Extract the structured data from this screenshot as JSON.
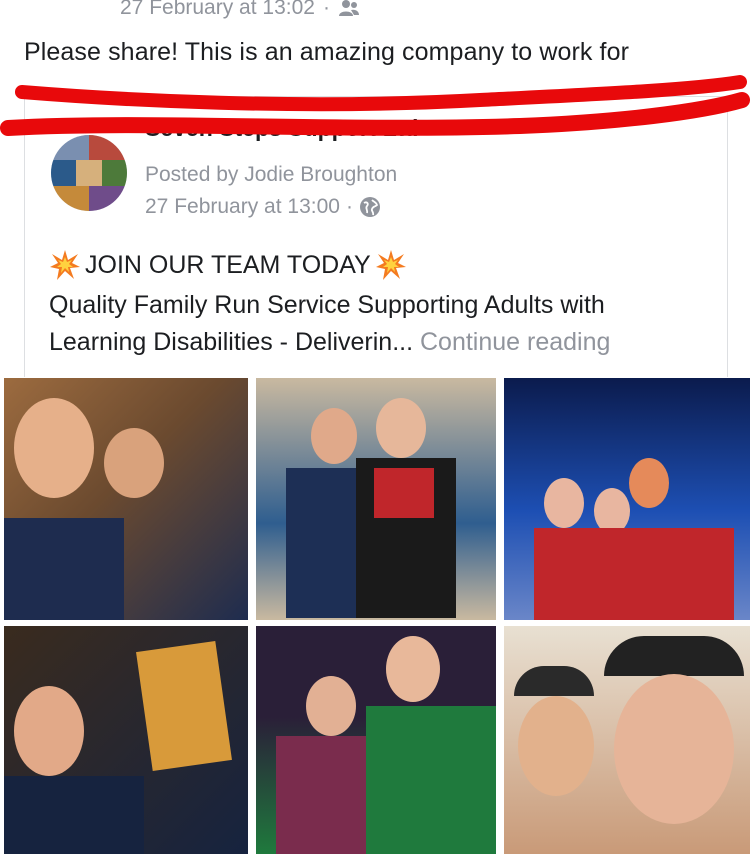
{
  "original_post": {
    "timestamp": "27 February at 13:02",
    "separator": "·",
    "audience_icon": "friends-icon",
    "text": "Please share! This is an amazing company to work for"
  },
  "shared_post": {
    "page_name": "Seven Steps Support Ltd",
    "posted_by": "Posted by Jodie Broughton",
    "timestamp": "27 February at 13:00",
    "separator": "·",
    "audience_icon": "globe-icon",
    "headline": "JOIN OUR TEAM TODAY",
    "headline_icon": "collision-emoji-icon",
    "description": "Quality Family Run Service Supporting Adults with Learning Disabilities - Deliverin...",
    "continue_label": "Continue reading"
  },
  "photos": [
    {
      "name": "photo-selfie-sofa",
      "colors": [
        "#6b4a2f",
        "#9c6b3f",
        "#1e2c4f"
      ]
    },
    {
      "name": "photo-christmas-jumpers",
      "colors": [
        "#2f5e8f",
        "#c9b9a0",
        "#1a1a1a"
      ]
    },
    {
      "name": "photo-bowling-alley",
      "colors": [
        "#1d4fb3",
        "#0b1b4d",
        "#c0262b"
      ]
    },
    {
      "name": "photo-mother-goose",
      "colors": [
        "#3a2b1e",
        "#16233f",
        "#d89a3a"
      ]
    },
    {
      "name": "photo-elf-jumper",
      "colors": [
        "#2a1f38",
        "#1f7a3d",
        "#7a2c4d"
      ]
    },
    {
      "name": "photo-hats-selfie",
      "colors": [
        "#e8e0d2",
        "#2a2a2a",
        "#c99a78"
      ]
    }
  ],
  "colors": {
    "annotation_red": "#e8090b",
    "meta_gray": "#90949c",
    "text": "#1c1e21"
  }
}
